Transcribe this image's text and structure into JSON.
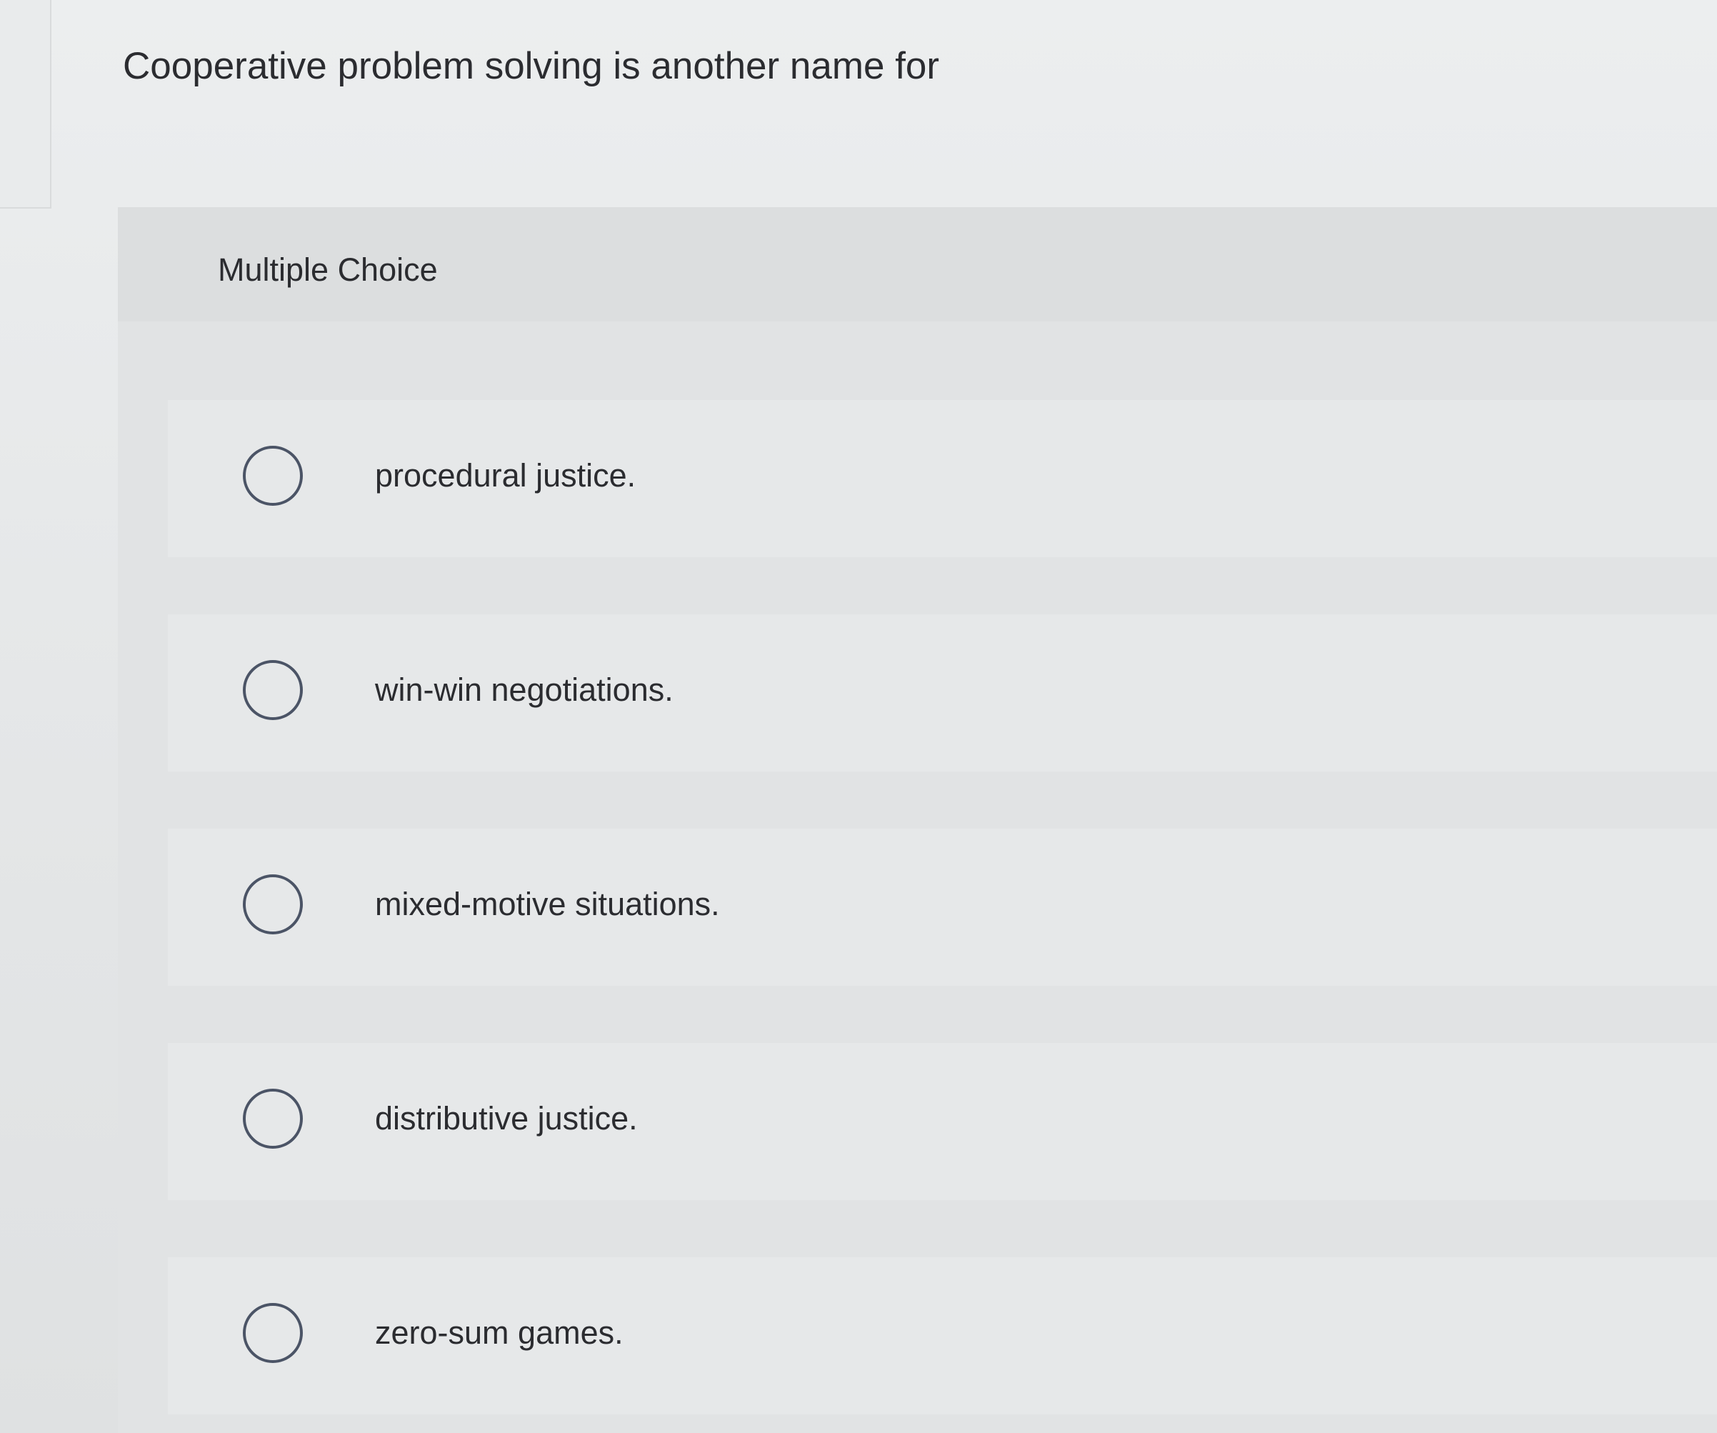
{
  "question": {
    "text": "Cooperative problem solving is another name for"
  },
  "question_type": "Multiple Choice",
  "options": [
    {
      "label": "procedural justice."
    },
    {
      "label": "win-win negotiations."
    },
    {
      "label": "mixed-motive situations."
    },
    {
      "label": "distributive justice."
    },
    {
      "label": "zero-sum games."
    }
  ],
  "colors": {
    "background": "#e6e8e9",
    "text": "#2b2c30",
    "radio_border": "#4b5466"
  }
}
